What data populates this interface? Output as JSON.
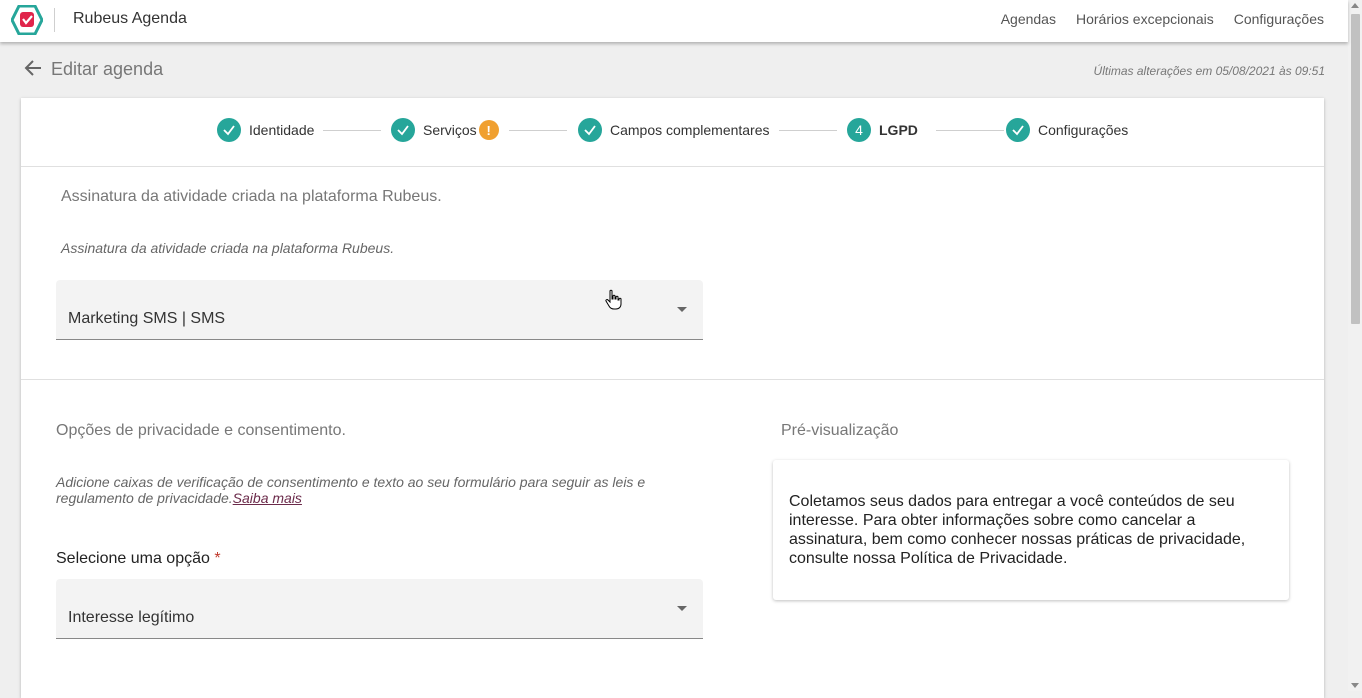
{
  "app": {
    "title": "Rubeus Agenda"
  },
  "nav": {
    "items": [
      "Agendas",
      "Horários excepcionais",
      "Configurações"
    ]
  },
  "header": {
    "title": "Editar agenda",
    "last_changes": "Últimas alterações em 05/08/2021 às 09:51"
  },
  "stepper": {
    "steps": [
      {
        "label": "Identidade",
        "state": "done"
      },
      {
        "label": "Serviços",
        "state": "done",
        "warning": "!"
      },
      {
        "label": "Campos complementares",
        "state": "done"
      },
      {
        "label": "LGPD",
        "state": "current",
        "number": "4"
      },
      {
        "label": "Configurações",
        "state": "done"
      }
    ]
  },
  "signature": {
    "title": "Assinatura da atividade criada na plataforma Rubeus.",
    "hint": "Assinatura da atividade criada na plataforma Rubeus.",
    "selected": "Marketing SMS | SMS"
  },
  "privacy": {
    "title": "Opções de privacidade e consentimento.",
    "hint": "Adicione caixas de verificação de consentimento e texto ao seu formulário para seguir as leis e regulamento de privacidade.",
    "link": "Saiba mais",
    "select_label": "Selecione uma opção",
    "required_mark": "*",
    "selected": "Interesse legítimo"
  },
  "preview": {
    "title": "Pré-visualização",
    "text": "Coletamos seus dados para entregar a você conteúdos de seu interesse. Para obter informações sobre como cancelar a assinatura, bem como conhecer nossas práticas de privacidade, consulte nossa Política de Privacidade."
  },
  "colors": {
    "accent": "#26a69a",
    "warning": "#f0a030",
    "logo": "#e0254b",
    "link": "#6b2a4a"
  }
}
